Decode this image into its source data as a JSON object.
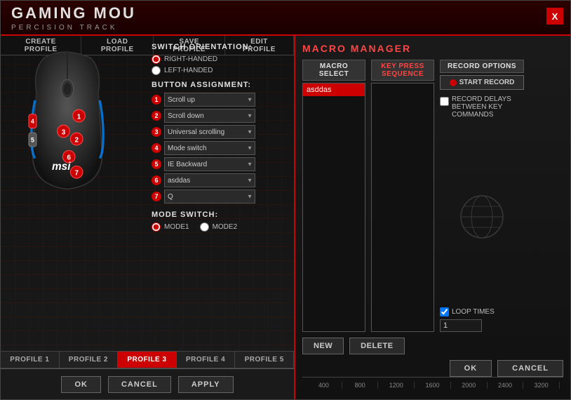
{
  "header": {
    "title": "GAMING MOU",
    "subtitle": "PERCISION TRACK",
    "close_label": "X"
  },
  "toolbar": {
    "create_profile": "CREATE PROFILE",
    "load_profile": "LOAD PROFILE",
    "save_profile": "SAVE PROFILE",
    "edit_profile": "EDIT PROFILE"
  },
  "switch_orientation": {
    "label": "SWITCH ORIENTATION:",
    "options": [
      "RIGHT-HANDED",
      "LEFT-HANDED"
    ]
  },
  "button_assignment": {
    "label": "BUTTON ASSIGNMENT:",
    "buttons": [
      {
        "num": "1",
        "value": "Scroll up"
      },
      {
        "num": "2",
        "value": "Scroll down"
      },
      {
        "num": "3",
        "value": "Universal scrolling"
      },
      {
        "num": "4",
        "value": "Mode switch"
      },
      {
        "num": "5",
        "value": "IE Backward"
      },
      {
        "num": "6",
        "value": "asddas"
      },
      {
        "num": "7",
        "value": "Q"
      }
    ]
  },
  "mode_switch": {
    "label": "MODE SWITCH:",
    "modes": [
      "MODE1",
      "MODE2"
    ]
  },
  "profiles": {
    "items": [
      "PROFILE 1",
      "PROFILE 2",
      "PROFILE 3",
      "PROFILE 4",
      "PROFILE 5"
    ],
    "active_index": 2
  },
  "bottom_buttons": {
    "ok": "OK",
    "cancel": "CANCEL",
    "apply": "APPLY"
  },
  "macro_manager": {
    "title": "MACRO MANAGER",
    "macro_select": {
      "header": "MACRO SELECT",
      "items": [
        "asddas"
      ],
      "selected": "asddas"
    },
    "key_press_sequence": {
      "header": "KEY PRESS SEQUENCE",
      "items": []
    },
    "record_options": {
      "header": "RECORD OPTIONS",
      "start_record": "START RECORD",
      "record_delays_label": "RECORD DELAYS BETWEEN KEY COMMANDS",
      "loop_times_label": "LOOP TIMES",
      "loop_times_value": "1"
    },
    "new_btn": "NEW",
    "delete_btn": "DELETE",
    "ok_btn": "OK",
    "cancel_btn": "CANCEL"
  },
  "timeline": {
    "markers": [
      "400",
      "800",
      "1200",
      "1600",
      "2000",
      "2400",
      "3200"
    ]
  }
}
